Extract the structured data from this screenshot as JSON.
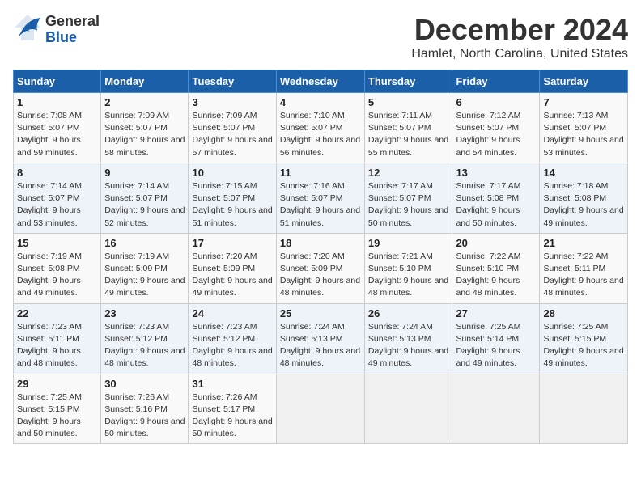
{
  "header": {
    "logo_general": "General",
    "logo_blue": "Blue",
    "title": "December 2024",
    "subtitle": "Hamlet, North Carolina, United States"
  },
  "days_of_week": [
    "Sunday",
    "Monday",
    "Tuesday",
    "Wednesday",
    "Thursday",
    "Friday",
    "Saturday"
  ],
  "weeks": [
    [
      {
        "num": "1",
        "sunrise": "7:08 AM",
        "sunset": "5:07 PM",
        "daylight": "9 hours and 59 minutes."
      },
      {
        "num": "2",
        "sunrise": "7:09 AM",
        "sunset": "5:07 PM",
        "daylight": "9 hours and 58 minutes."
      },
      {
        "num": "3",
        "sunrise": "7:09 AM",
        "sunset": "5:07 PM",
        "daylight": "9 hours and 57 minutes."
      },
      {
        "num": "4",
        "sunrise": "7:10 AM",
        "sunset": "5:07 PM",
        "daylight": "9 hours and 56 minutes."
      },
      {
        "num": "5",
        "sunrise": "7:11 AM",
        "sunset": "5:07 PM",
        "daylight": "9 hours and 55 minutes."
      },
      {
        "num": "6",
        "sunrise": "7:12 AM",
        "sunset": "5:07 PM",
        "daylight": "9 hours and 54 minutes."
      },
      {
        "num": "7",
        "sunrise": "7:13 AM",
        "sunset": "5:07 PM",
        "daylight": "9 hours and 53 minutes."
      }
    ],
    [
      {
        "num": "8",
        "sunrise": "7:14 AM",
        "sunset": "5:07 PM",
        "daylight": "9 hours and 53 minutes."
      },
      {
        "num": "9",
        "sunrise": "7:14 AM",
        "sunset": "5:07 PM",
        "daylight": "9 hours and 52 minutes."
      },
      {
        "num": "10",
        "sunrise": "7:15 AM",
        "sunset": "5:07 PM",
        "daylight": "9 hours and 51 minutes."
      },
      {
        "num": "11",
        "sunrise": "7:16 AM",
        "sunset": "5:07 PM",
        "daylight": "9 hours and 51 minutes."
      },
      {
        "num": "12",
        "sunrise": "7:17 AM",
        "sunset": "5:07 PM",
        "daylight": "9 hours and 50 minutes."
      },
      {
        "num": "13",
        "sunrise": "7:17 AM",
        "sunset": "5:08 PM",
        "daylight": "9 hours and 50 minutes."
      },
      {
        "num": "14",
        "sunrise": "7:18 AM",
        "sunset": "5:08 PM",
        "daylight": "9 hours and 49 minutes."
      }
    ],
    [
      {
        "num": "15",
        "sunrise": "7:19 AM",
        "sunset": "5:08 PM",
        "daylight": "9 hours and 49 minutes."
      },
      {
        "num": "16",
        "sunrise": "7:19 AM",
        "sunset": "5:09 PM",
        "daylight": "9 hours and 49 minutes."
      },
      {
        "num": "17",
        "sunrise": "7:20 AM",
        "sunset": "5:09 PM",
        "daylight": "9 hours and 49 minutes."
      },
      {
        "num": "18",
        "sunrise": "7:20 AM",
        "sunset": "5:09 PM",
        "daylight": "9 hours and 48 minutes."
      },
      {
        "num": "19",
        "sunrise": "7:21 AM",
        "sunset": "5:10 PM",
        "daylight": "9 hours and 48 minutes."
      },
      {
        "num": "20",
        "sunrise": "7:22 AM",
        "sunset": "5:10 PM",
        "daylight": "9 hours and 48 minutes."
      },
      {
        "num": "21",
        "sunrise": "7:22 AM",
        "sunset": "5:11 PM",
        "daylight": "9 hours and 48 minutes."
      }
    ],
    [
      {
        "num": "22",
        "sunrise": "7:23 AM",
        "sunset": "5:11 PM",
        "daylight": "9 hours and 48 minutes."
      },
      {
        "num": "23",
        "sunrise": "7:23 AM",
        "sunset": "5:12 PM",
        "daylight": "9 hours and 48 minutes."
      },
      {
        "num": "24",
        "sunrise": "7:23 AM",
        "sunset": "5:12 PM",
        "daylight": "9 hours and 48 minutes."
      },
      {
        "num": "25",
        "sunrise": "7:24 AM",
        "sunset": "5:13 PM",
        "daylight": "9 hours and 48 minutes."
      },
      {
        "num": "26",
        "sunrise": "7:24 AM",
        "sunset": "5:13 PM",
        "daylight": "9 hours and 49 minutes."
      },
      {
        "num": "27",
        "sunrise": "7:25 AM",
        "sunset": "5:14 PM",
        "daylight": "9 hours and 49 minutes."
      },
      {
        "num": "28",
        "sunrise": "7:25 AM",
        "sunset": "5:15 PM",
        "daylight": "9 hours and 49 minutes."
      }
    ],
    [
      {
        "num": "29",
        "sunrise": "7:25 AM",
        "sunset": "5:15 PM",
        "daylight": "9 hours and 50 minutes."
      },
      {
        "num": "30",
        "sunrise": "7:26 AM",
        "sunset": "5:16 PM",
        "daylight": "9 hours and 50 minutes."
      },
      {
        "num": "31",
        "sunrise": "7:26 AM",
        "sunset": "5:17 PM",
        "daylight": "9 hours and 50 minutes."
      },
      null,
      null,
      null,
      null
    ]
  ]
}
